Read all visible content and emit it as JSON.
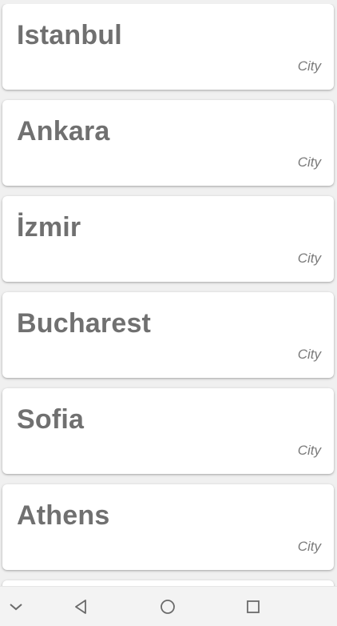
{
  "cities": [
    {
      "name": "Istanbul",
      "type": "City"
    },
    {
      "name": "Ankara",
      "type": "City"
    },
    {
      "name": "İzmir",
      "type": "City"
    },
    {
      "name": "Bucharest",
      "type": "City"
    },
    {
      "name": "Sofia",
      "type": "City"
    },
    {
      "name": "Athens",
      "type": "City"
    }
  ],
  "navbar": {
    "icons": [
      "chevron-down-icon",
      "back-icon",
      "home-icon",
      "recents-icon"
    ]
  }
}
